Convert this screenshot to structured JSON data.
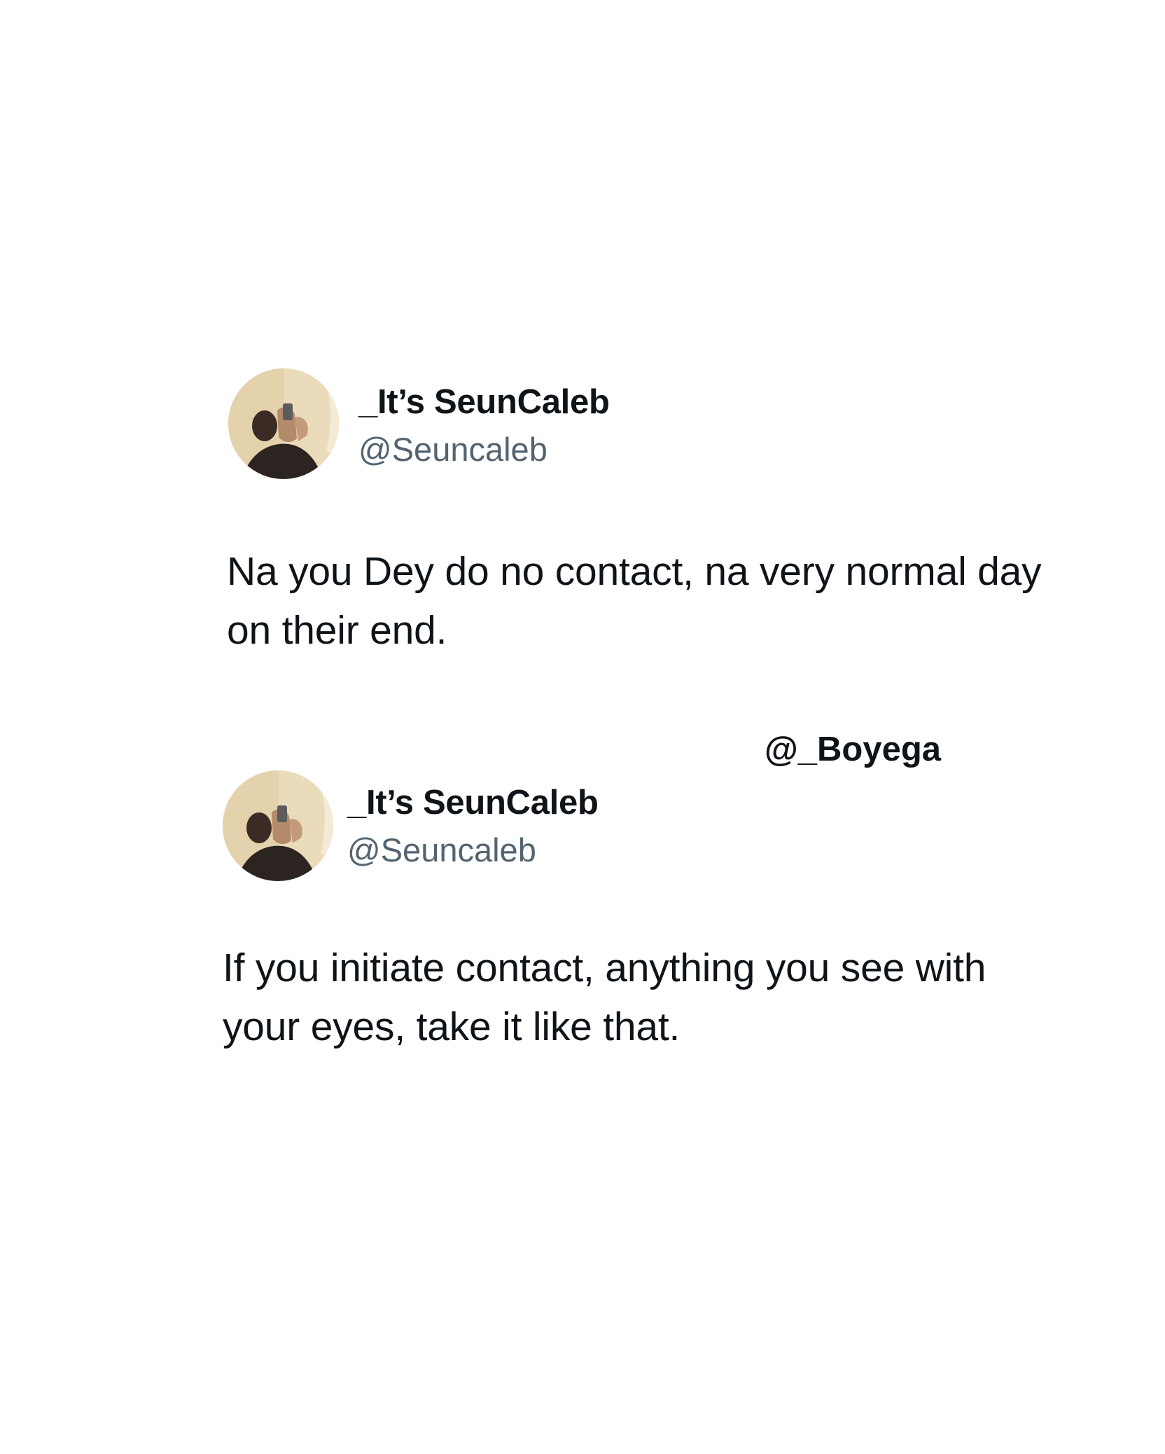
{
  "tweets": [
    {
      "display_name": "_It’s SeunCaleb",
      "handle": "@Seuncaleb",
      "text": "Na you Dey do no contact, na very normal day on their end.",
      "avatar_icon": "profile-photo"
    },
    {
      "display_name": "_It’s SeunCaleb",
      "handle": "@Seuncaleb",
      "text": "If you initiate contact, anything you see with your eyes, take it like that.",
      "avatar_icon": "profile-photo"
    }
  ],
  "watermark": "@_Boyega",
  "colors": {
    "background": "#ffffff",
    "name": "#0f1419",
    "handle": "#536471",
    "text": "#0f1419"
  }
}
